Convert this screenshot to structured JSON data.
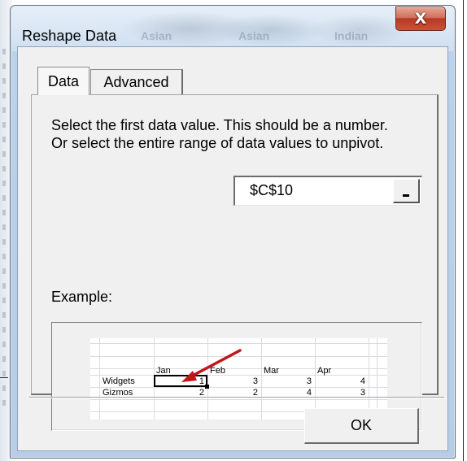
{
  "window": {
    "title": "Reshape Data",
    "close_glyph": "X",
    "background_titles": [
      "Asian",
      "Asian",
      "Indian"
    ]
  },
  "tabs": [
    {
      "label": "Data",
      "active": true
    },
    {
      "label": "Advanced",
      "active": false
    }
  ],
  "panel": {
    "instructions": "Select the first data value.  This should be a number.  Or select the entire range of data values to unpivot.",
    "range_value": "$C$10",
    "range_button_icon": "collapse-dialog-icon",
    "example_label": "Example:"
  },
  "example": {
    "columns": [
      "Jan",
      "Feb",
      "Mar",
      "Apr"
    ],
    "rows": [
      {
        "label": "Widgets",
        "values": [
          "1",
          "3",
          "3",
          "4"
        ]
      },
      {
        "label": "Gizmos",
        "values": [
          "2",
          "2",
          "4",
          "3"
        ]
      }
    ],
    "arrow_color": "#c0161a"
  },
  "buttons": {
    "ok_label": "OK"
  },
  "colors": {
    "close_button": "#c9523a",
    "titlebar": "#cfdff0",
    "client": "#f0f0f0"
  }
}
